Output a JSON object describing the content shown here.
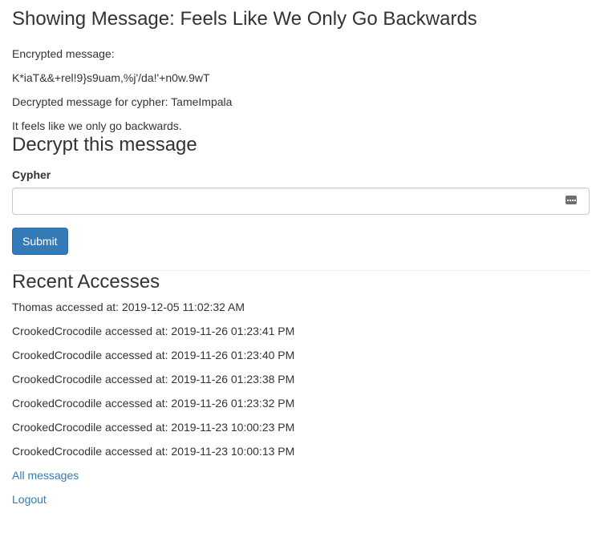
{
  "header": {
    "title": "Showing Message: Feels Like We Only Go Backwards"
  },
  "message": {
    "encrypted_label": "Encrypted message:",
    "encrypted_value": "K*iaT&&+rel!9}s9uam,%j'/da!'+n0w.9wT",
    "decrypted_label": "Decrypted message for cypher: TameImpala",
    "decrypted_value": "It feels like we only go backwards."
  },
  "decrypt_form": {
    "heading": "Decrypt this message",
    "cypher_label": "Cypher",
    "cypher_value": "",
    "key_icon": "password-manager-icon",
    "submit_label": "Submit",
    "accent_color": "#337ab7"
  },
  "recent_accesses": {
    "heading": "Recent Accesses",
    "items": [
      "Thomas accessed at: 2019-12-05 11:02:32 AM",
      "CrookedCrocodile accessed at: 2019-11-26 01:23:41 PM",
      "CrookedCrocodile accessed at: 2019-11-26 01:23:40 PM",
      "CrookedCrocodile accessed at: 2019-11-26 01:23:38 PM",
      "CrookedCrocodile accessed at: 2019-11-26 01:23:32 PM",
      "CrookedCrocodile accessed at: 2019-11-23 10:00:23 PM",
      "CrookedCrocodile accessed at: 2019-11-23 10:00:13 PM"
    ]
  },
  "links": {
    "all_messages": "All messages",
    "logout": "Logout"
  }
}
